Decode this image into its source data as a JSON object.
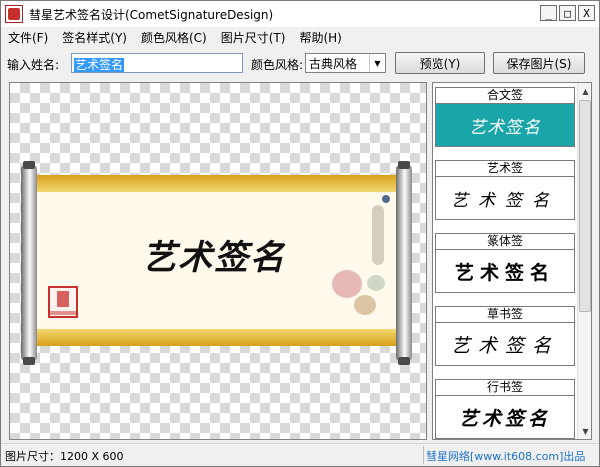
{
  "window": {
    "title": "彗星艺术签名设计(CometSignatureDesign)",
    "controls": [
      "_",
      "□",
      "X"
    ]
  },
  "menu": [
    {
      "label": "文件(F)"
    },
    {
      "label": "签名样式(Y)"
    },
    {
      "label": "颜色风格(C)"
    },
    {
      "label": "图片尺寸(T)"
    },
    {
      "label": "帮助(H)"
    }
  ],
  "toolbar": {
    "name_label": "输入姓名:",
    "name_value": "艺术签名",
    "color_label": "颜色风格:",
    "color_value": "古典风格",
    "preview_button": "预览(Y)",
    "save_button": "保存图片(S)"
  },
  "preview": {
    "signature_text": "艺术签名"
  },
  "styles": [
    {
      "header": "合文签",
      "sample": "艺术签名",
      "selected": true
    },
    {
      "header": "艺术签",
      "sample": "艺术签名",
      "selected": false
    },
    {
      "header": "篆体签",
      "sample": "艺术签名",
      "selected": false
    },
    {
      "header": "草书签",
      "sample": "艺术签名",
      "selected": false
    },
    {
      "header": "行书签",
      "sample": "艺术签名",
      "selected": false
    }
  ],
  "status": {
    "size_text": "图片尺寸：1200 X 600",
    "credit": "彗星网络[www.it608.com]出品"
  },
  "colors": {
    "selected_card": "#1aa5a8",
    "scroll_gold": "#d8a11a",
    "seal_red": "#c8302e",
    "credit_blue": "#1c73c9"
  }
}
